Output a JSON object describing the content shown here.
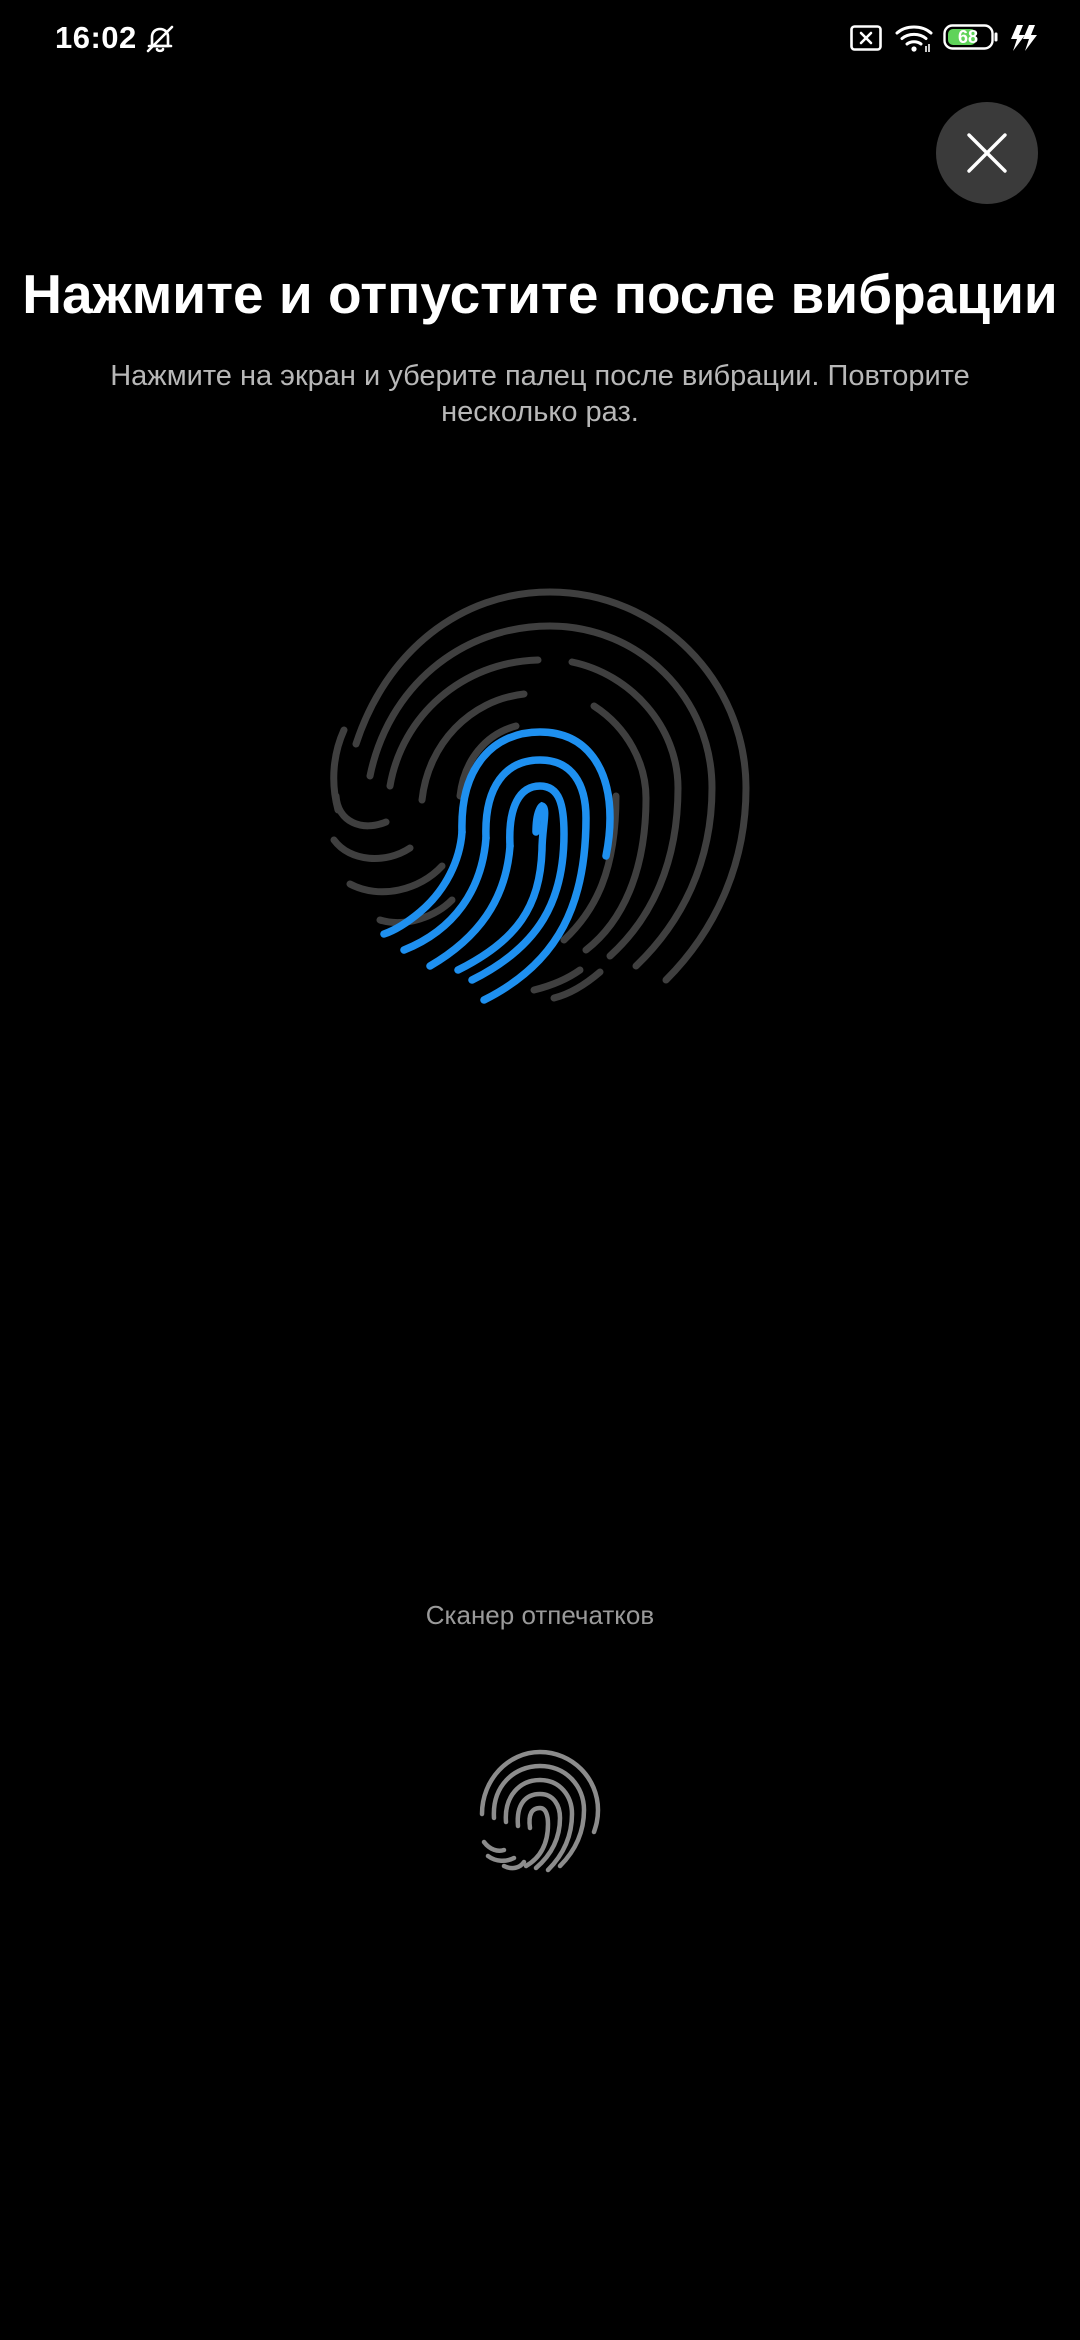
{
  "status_bar": {
    "time": "16:02",
    "battery_level": "68",
    "icons": [
      "bell-off-icon",
      "sim-x-icon",
      "wifi-icon",
      "battery-icon",
      "charging-bolt-icon"
    ]
  },
  "dialog": {
    "title": "Нажмите и отпустите после вибрации",
    "subtitle": "Нажмите на экран и уберите палец после вибрации. Повторите несколько раз.",
    "close_icon": "close-icon"
  },
  "scanner": {
    "label": "Сканер отпечатков",
    "icon": "fingerprint-icon"
  },
  "colors": {
    "background": "#000000",
    "progress_ridge": "#1e90f0",
    "inactive_ridge": "#3f3f3f",
    "scanner_ridge": "#8c8c8c",
    "battery_fill": "#5fd35a",
    "close_bg": "#3a3a3a"
  }
}
